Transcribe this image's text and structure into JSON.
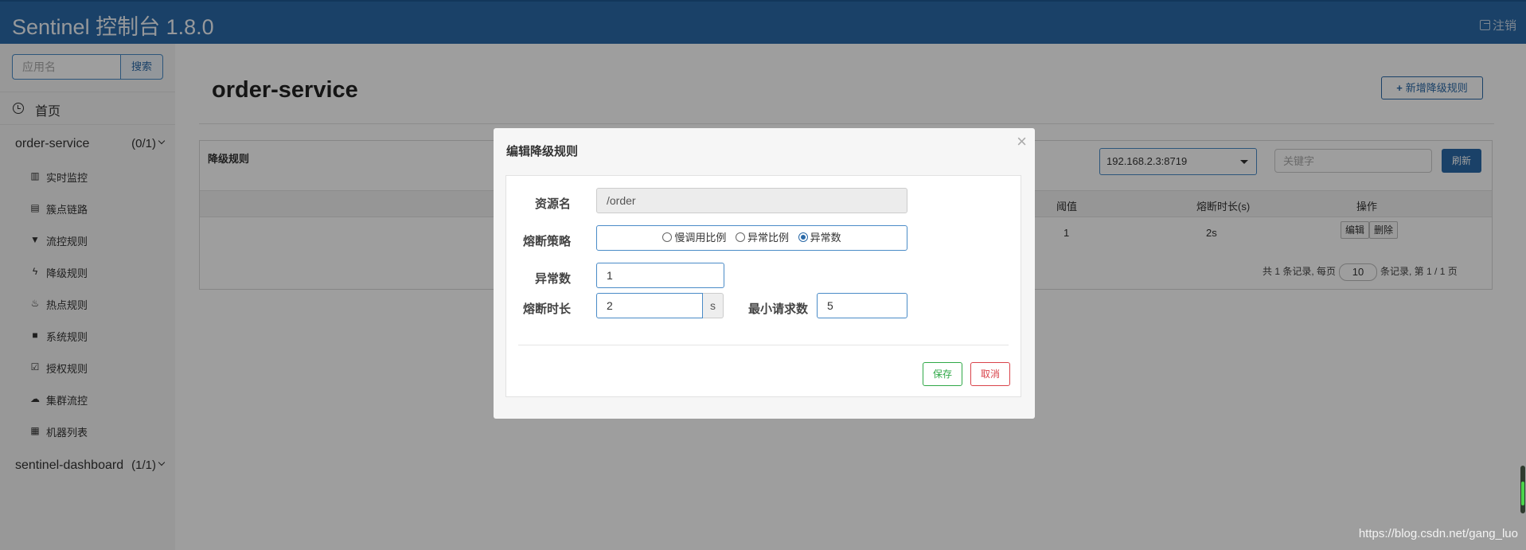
{
  "header": {
    "title": "Sentinel 控制台 1.8.0",
    "logout": "注销"
  },
  "sidebar": {
    "search_placeholder": "应用名",
    "search_button": "搜索",
    "home": "首页",
    "apps": [
      {
        "name": "order-service",
        "count": "(0/1)"
      },
      {
        "name": "sentinel-dashboard",
        "count": "(1/1)"
      }
    ],
    "menu": [
      {
        "label": "实时监控",
        "icon": "bar-chart-icon"
      },
      {
        "label": "簇点链路",
        "icon": "list-icon"
      },
      {
        "label": "流控规则",
        "icon": "filter-icon"
      },
      {
        "label": "降级规则",
        "icon": "flash-icon"
      },
      {
        "label": "热点规则",
        "icon": "fire-icon"
      },
      {
        "label": "系统规则",
        "icon": "lock-icon"
      },
      {
        "label": "授权规则",
        "icon": "check-icon"
      },
      {
        "label": "集群流控",
        "icon": "cloud-icon"
      },
      {
        "label": "机器列表",
        "icon": "th-list-icon"
      }
    ]
  },
  "main": {
    "page_title": "order-service",
    "add_rule_button": "新增降级规则",
    "panel_title": "降级规则",
    "machine_select": "192.168.2.3:8719",
    "keyword_placeholder": "关键字",
    "refresh_button": "刷新",
    "columns": [
      "阈值",
      "熔断时长(s)",
      "操作"
    ],
    "row": {
      "threshold": "1",
      "duration": "2s",
      "edit": "编辑",
      "delete": "删除"
    },
    "pager": {
      "prefix": "共 1 条记录, 每页",
      "page_size": "10",
      "suffix": "条记录, 第 1 / 1 页"
    }
  },
  "modal": {
    "title": "编辑降级规则",
    "close": "×",
    "resource_label": "资源名",
    "resource_value": "/order",
    "strategy_label": "熔断策略",
    "strategies": [
      {
        "label": "慢调用比例",
        "checked": false
      },
      {
        "label": "异常比例",
        "checked": false
      },
      {
        "label": "异常数",
        "checked": true
      }
    ],
    "exception_count_label": "异常数",
    "exception_count_value": "1",
    "duration_label": "熔断时长",
    "duration_value": "2",
    "duration_unit": "s",
    "min_request_label": "最小请求数",
    "min_request_value": "5",
    "save": "保存",
    "cancel": "取消"
  },
  "watermark": "https://blog.csdn.net/gang_luo",
  "colors": {
    "header": "#2b6aa8",
    "save": "#2fa847",
    "cancel": "#d9434a"
  }
}
